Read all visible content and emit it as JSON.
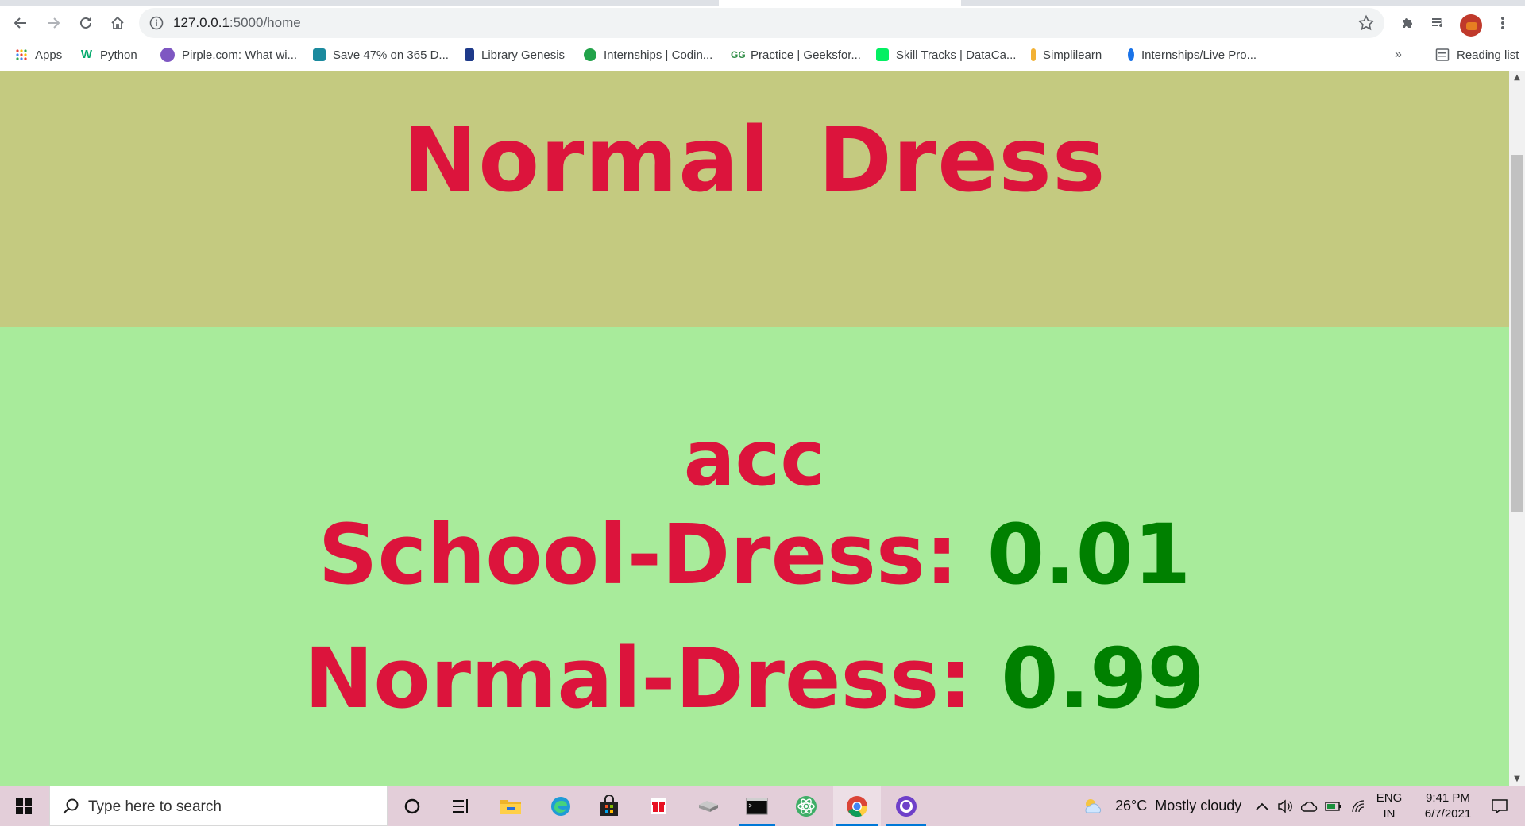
{
  "browser": {
    "url_host": "127.0.0.1",
    "url_path": ":5000/home",
    "bookmarks": [
      {
        "label": "Apps",
        "icon": "apps-grid-icon",
        "color": "#ea4335"
      },
      {
        "label": "Python",
        "icon": "w3schools-icon",
        "color": "#04aa6d"
      },
      {
        "label": "Pirple.com: What wi...",
        "icon": "pirple-icon",
        "color": "#7e57c2"
      },
      {
        "label": "Save 47% on 365 D...",
        "icon": "datacamp-icon",
        "color": "#1b8a9e"
      },
      {
        "label": "Library Genesis",
        "icon": "libgen-icon",
        "color": "#1e3a8a"
      },
      {
        "label": "Internships | Codin...",
        "icon": "codin-icon",
        "color": "#22a34a"
      },
      {
        "label": "Practice | Geeksfor...",
        "icon": "gfg-icon",
        "color": "#2f8d46"
      },
      {
        "label": "Skill Tracks | DataCa...",
        "icon": "datacamp-skill-icon",
        "color": "#03ef62"
      },
      {
        "label": "Simplilearn",
        "icon": "simplilearn-icon",
        "color": "#f2b134"
      },
      {
        "label": "Internships/Live Pro...",
        "icon": "internships-icon",
        "color": "#1a73e8"
      }
    ],
    "more_label": "»",
    "reading_list_label": "Reading list"
  },
  "page": {
    "title": "Normal Dress",
    "acc_label": "acc",
    "school_label": "School-Dress:",
    "school_value": "0.01",
    "normal_label": "Normal-Dress:",
    "normal_value": "0.99",
    "colors": {
      "top_bg": "#c4ca80",
      "bottom_bg": "#a8eb9b",
      "label": "#dc143c",
      "value": "#008000"
    }
  },
  "taskbar": {
    "search_placeholder": "Type here to search",
    "weather": "26°C  Mostly cloudy",
    "language_top": "ENG",
    "language_bottom": "IN",
    "time": "9:41 PM",
    "date": "6/7/2021"
  }
}
